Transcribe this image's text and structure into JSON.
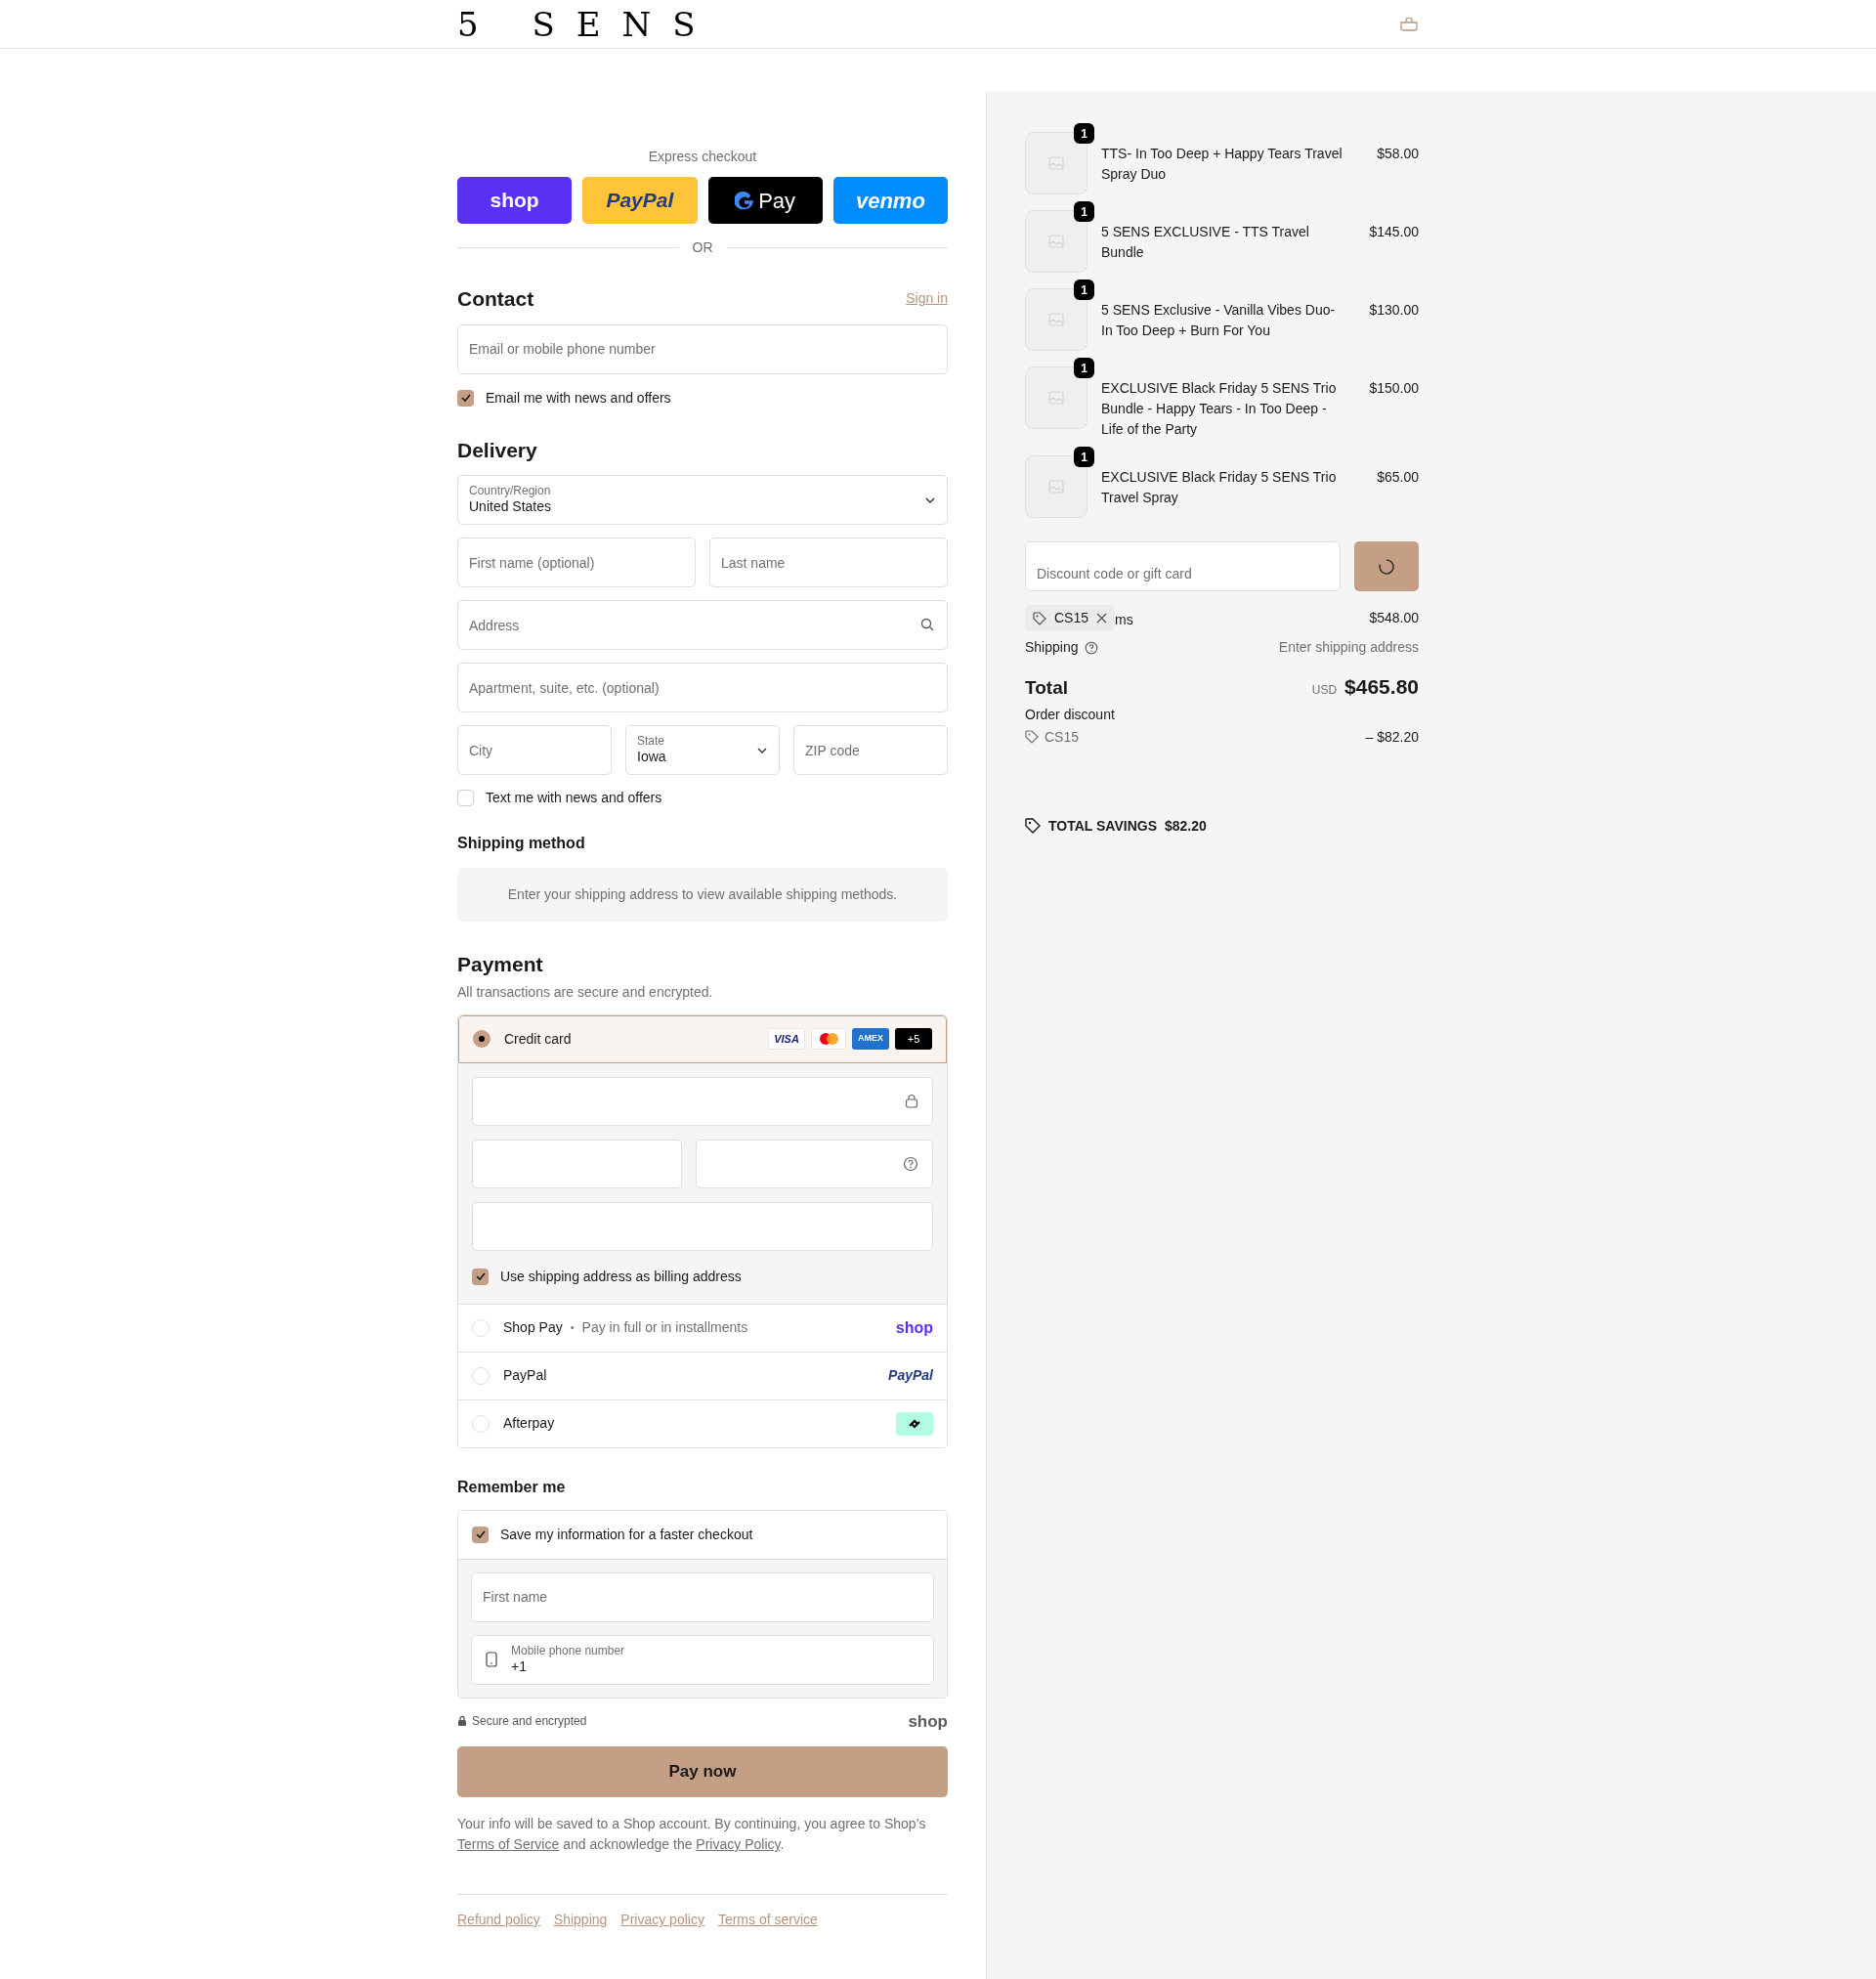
{
  "header": {
    "logo": "5 SENS"
  },
  "express": {
    "label": "Express checkout",
    "buttons": [
      {
        "kind": "shop",
        "label": "shop"
      },
      {
        "kind": "paypal",
        "label": "PayPal"
      },
      {
        "kind": "gpay",
        "label": "Pay"
      },
      {
        "kind": "venmo",
        "label": "venmo"
      }
    ],
    "or": "OR"
  },
  "contact": {
    "title": "Contact",
    "sign_in": "Sign in",
    "email_placeholder": "Email or mobile phone number",
    "news": {
      "label": "Email me with news and offers",
      "checked": true
    }
  },
  "delivery": {
    "title": "Delivery",
    "country": {
      "label": "Country/Region",
      "value": "United States"
    },
    "first_name_placeholder": "First name (optional)",
    "last_name_placeholder": "Last name",
    "address_placeholder": "Address",
    "apartment_placeholder": "Apartment, suite, etc. (optional)",
    "city_placeholder": "City",
    "state": {
      "label": "State",
      "value": "Iowa"
    },
    "zip_placeholder": "ZIP code",
    "sms": {
      "label": "Text me with news and offers",
      "checked": false
    }
  },
  "shipping_method": {
    "title": "Shipping method",
    "message": "Enter your shipping address to view available shipping methods."
  },
  "payment": {
    "title": "Payment",
    "subtitle": "All transactions are secure and encrypted.",
    "methods": [
      {
        "kind": "card",
        "label": "Credit card",
        "selected": true,
        "brands": [
          {
            "kind": "visa",
            "label": "VISA"
          },
          {
            "kind": "mastercard"
          },
          {
            "kind": "amex",
            "label": "AMEX"
          },
          {
            "kind": "more",
            "label": "+5"
          }
        ],
        "billing": {
          "label": "Use shipping address as billing address",
          "checked": true
        }
      },
      {
        "kind": "shoppay",
        "label": "Shop Pay",
        "separator": "•",
        "note": "Pay in full or in installments",
        "logo": "shop",
        "selected": false
      },
      {
        "kind": "paypal",
        "label": "PayPal",
        "logo": "PayPal",
        "selected": false
      },
      {
        "kind": "afterpay",
        "label": "Afterpay",
        "selected": false
      }
    ]
  },
  "remember": {
    "title": "Remember me",
    "save": {
      "label": "Save my information for a faster checkout",
      "checked": true
    },
    "first_name_placeholder": "First name",
    "phone": {
      "label": "Mobile phone number",
      "value": "+1"
    }
  },
  "secure": {
    "label": "Secure and encrypted",
    "logo": "shop"
  },
  "pay_button": "Pay now",
  "legal": [
    {
      "kind": "text",
      "text": "Your info will be saved to a Shop account. By continuing, you agree to Shop’s "
    },
    {
      "kind": "link",
      "text": "Terms of Service"
    },
    {
      "kind": "text",
      "text": " and acknowledge the "
    },
    {
      "kind": "link",
      "text": "Privacy Policy"
    },
    {
      "kind": "text",
      "text": "."
    }
  ],
  "footer_links": [
    "Refund policy",
    "Shipping",
    "Privacy policy",
    "Terms of service"
  ],
  "summary": {
    "items": [
      {
        "title": "TTS- In Too Deep + Happy Tears Travel Spray Duo",
        "price": "$58.00",
        "quantity": "1"
      },
      {
        "title": "5 SENS EXCLUSIVE - TTS Travel Bundle",
        "price": "$145.00",
        "quantity": "1"
      },
      {
        "title": "5 SENS Exclusive - Vanilla Vibes Duo- In Too Deep + Burn For You",
        "price": "$130.00",
        "quantity": "1"
      },
      {
        "title": "EXCLUSIVE Black Friday 5 SENS Trio Bundle - Happy Tears - In Too Deep - Life of the Party",
        "price": "$150.00",
        "quantity": "1"
      },
      {
        "title": "EXCLUSIVE Black Friday 5 SENS Trio Travel Spray",
        "price": "$65.00",
        "quantity": "1"
      }
    ],
    "discount_placeholder": "Discount code or gift card",
    "applied_code": "CS15",
    "subtotal_label": "ms",
    "subtotal": "$548.00",
    "shipping_label": "Shipping",
    "shipping_value": "Enter shipping address",
    "total_label": "Total",
    "currency": "USD",
    "total": "$465.80",
    "order_discount_label": "Order discount",
    "discount_code": "CS15",
    "discount_amount": "– $82.20",
    "savings_label": "TOTAL SAVINGS",
    "savings_amount": "$82.20"
  }
}
